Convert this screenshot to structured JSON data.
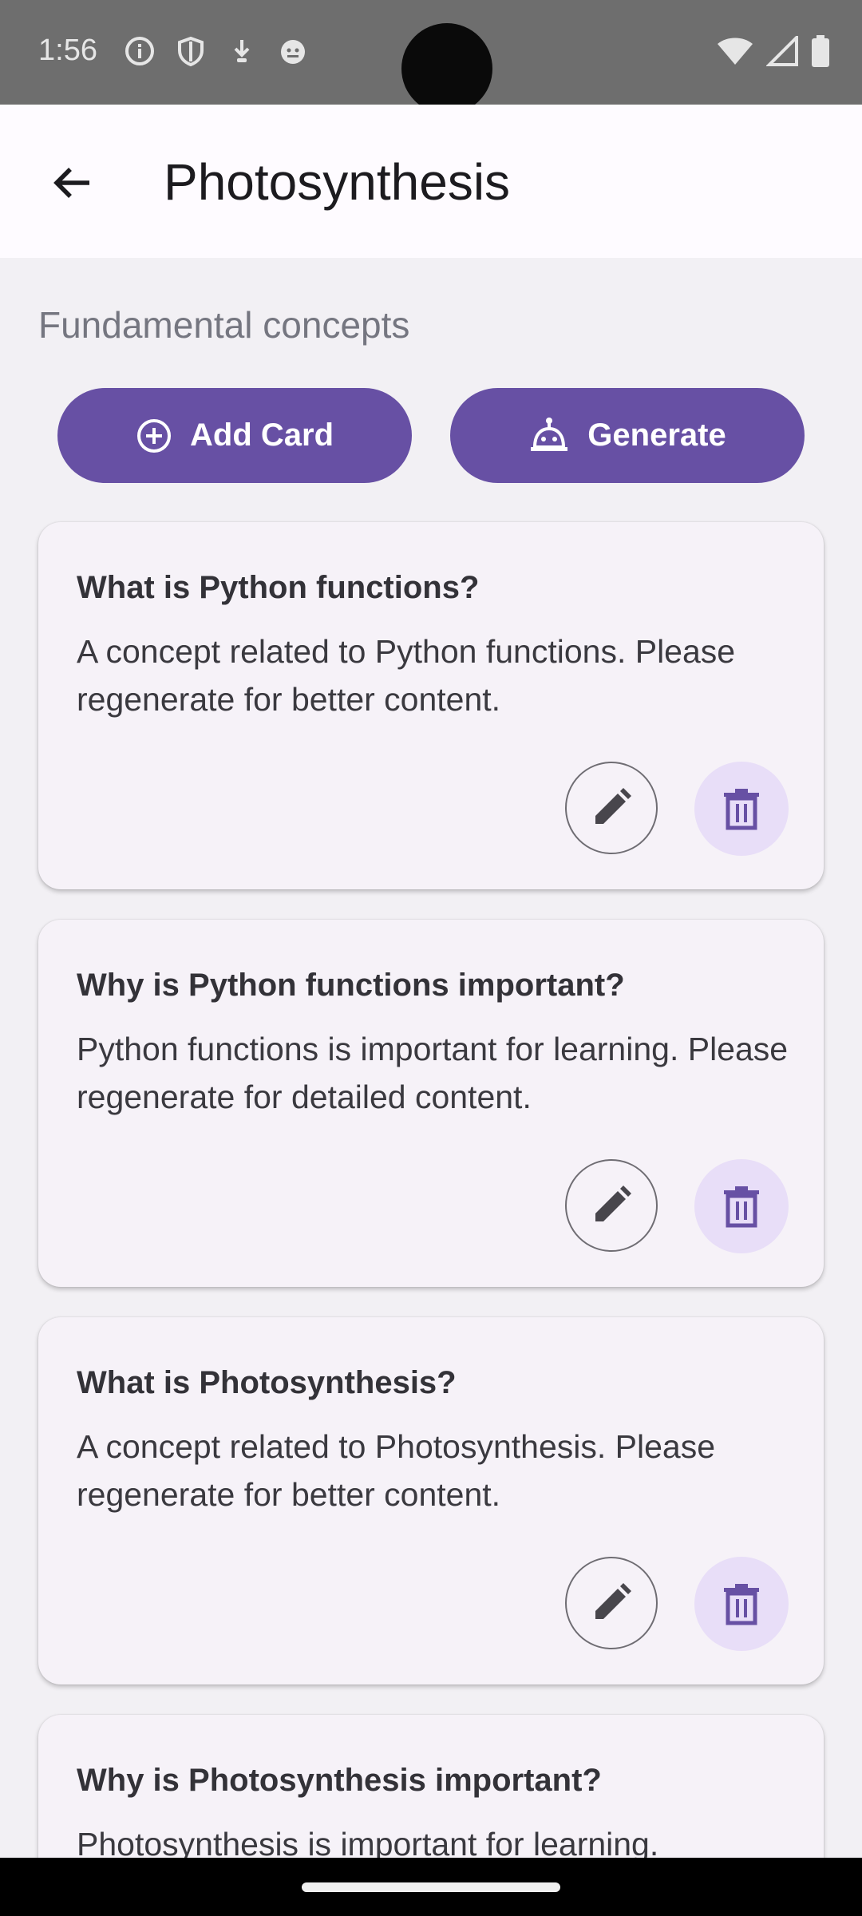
{
  "status_bar": {
    "time": "1:56"
  },
  "app_bar": {
    "title": "Photosynthesis"
  },
  "section": {
    "label": "Fundamental concepts"
  },
  "actions": {
    "add_label": "Add Card",
    "generate_label": "Generate"
  },
  "cards": [
    {
      "question": "What is Python functions?",
      "answer": "A concept related to Python functions. Please regenerate for better content."
    },
    {
      "question": "Why is Python functions important?",
      "answer": "Python functions is important for learning. Please regenerate for detailed content."
    },
    {
      "question": "What is Photosynthesis?",
      "answer": "A concept related to Photosynthesis. Please regenerate for better content."
    },
    {
      "question": "Why is Photosynthesis important?",
      "answer": "Photosynthesis is important for learning."
    }
  ],
  "colors": {
    "primary": "#6750a4",
    "delete_bg": "#e8def8",
    "card_bg": "#f6f2f8",
    "page_bg": "#f2f0f4"
  }
}
